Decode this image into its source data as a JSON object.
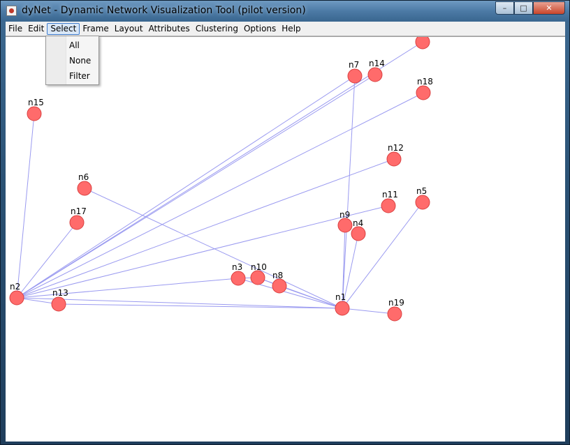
{
  "window": {
    "title": "dyNet - Dynamic Network Visualization Tool (pilot version)",
    "buttons": [
      "–",
      "□",
      "✕"
    ]
  },
  "menubar": {
    "items": [
      "File",
      "Edit",
      "Select",
      "Frame",
      "Layout",
      "Attributes",
      "Clustering",
      "Options",
      "Help"
    ],
    "active": "Select"
  },
  "select_menu": {
    "items": [
      "All",
      "None",
      "Filter"
    ]
  },
  "graph": {
    "node_color": "#ff6b6b",
    "node_stroke": "#d94040",
    "edge_color": "#9a9af0",
    "nodes": [
      {
        "id": "n1"
      },
      {
        "id": "n2"
      },
      {
        "id": "n3"
      },
      {
        "id": "n4"
      },
      {
        "id": "n5"
      },
      {
        "id": "n6"
      },
      {
        "id": "n7"
      },
      {
        "id": "n8"
      },
      {
        "id": "n9"
      },
      {
        "id": "n10"
      },
      {
        "id": "n11"
      },
      {
        "id": "n12"
      },
      {
        "id": "n13"
      },
      {
        "id": "n14"
      },
      {
        "id": "n15"
      },
      {
        "id": "n17"
      },
      {
        "id": "n18"
      },
      {
        "id": "n19"
      },
      {
        "id": ""
      }
    ],
    "edges": [
      [
        "n2",
        "n15"
      ],
      [
        "n2",
        "n17"
      ],
      [
        "n2",
        "n13"
      ],
      [
        "n2",
        "n7"
      ],
      [
        "n2",
        "n14"
      ],
      [
        "n2",
        ""
      ],
      [
        "n2",
        "n18"
      ],
      [
        "n2",
        "n12"
      ],
      [
        "n2",
        "n11"
      ],
      [
        "n2",
        "n3"
      ],
      [
        "n2",
        "n1"
      ],
      [
        "n13",
        "n1"
      ],
      [
        "n6",
        "n1"
      ],
      [
        "n3",
        "n1"
      ],
      [
        "n10",
        "n1"
      ],
      [
        "n8",
        "n1"
      ],
      [
        "n7",
        "n1"
      ],
      [
        "n9",
        "n1"
      ],
      [
        "n4",
        "n1"
      ],
      [
        "n5",
        "n1"
      ],
      [
        "n1",
        "n19"
      ],
      [
        "n3",
        "n10"
      ],
      [
        "n10",
        "n8"
      ]
    ]
  }
}
